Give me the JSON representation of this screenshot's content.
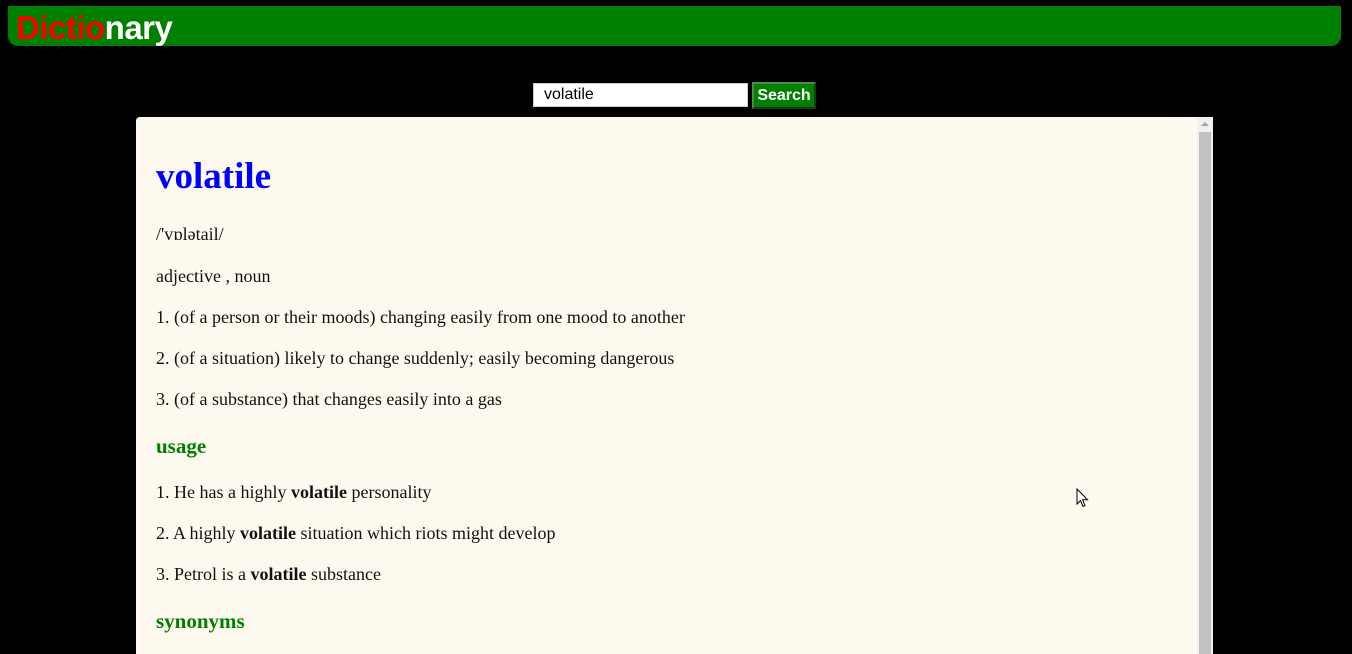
{
  "header": {
    "logo_part1": "Dictio",
    "logo_part2": "nary",
    "logo_part1_color": "#ff0000",
    "logo_part2_color": "#ffffff",
    "bg_color": "#008000"
  },
  "search": {
    "value": "volatile",
    "button_label": "Search"
  },
  "entry": {
    "word": "volatile",
    "pronunciation": "/'vɒlətail/",
    "part_of_speech": "adjective , noun",
    "definitions": [
      "1. (of a person or their moods) changing easily from one mood to another",
      "2. (of a situation) likely to change suddenly; easily becoming dangerous",
      "3. (of a substance) that changes easily into a gas"
    ],
    "usage_heading": "usage",
    "usage": [
      {
        "before": "1. He has a highly ",
        "bold": "volatile",
        "after": " personality"
      },
      {
        "before": "2. A highly ",
        "bold": "volatile",
        "after": " situation which riots might develop"
      },
      {
        "before": "3. Petrol is a ",
        "bold": "volatile",
        "after": " substance"
      }
    ],
    "synonyms_heading": "synonyms"
  },
  "colors": {
    "word": "#0000ff",
    "section_heading": "#008000",
    "content_bg": "#fdf9ee",
    "page_bg": "#000000"
  }
}
